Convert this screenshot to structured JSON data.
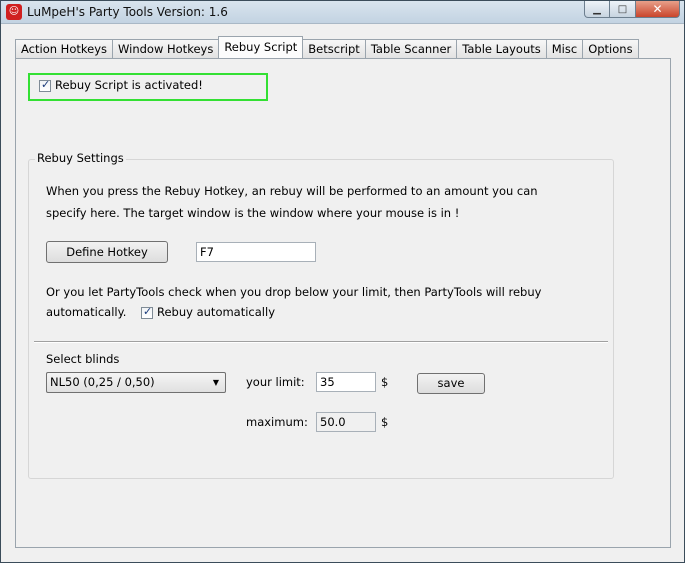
{
  "window": {
    "title": "LuMpeH's Party Tools   Version: 1.6",
    "icon": "app-icon"
  },
  "tabs": [
    {
      "label": "Action Hotkeys"
    },
    {
      "label": "Window Hotkeys"
    },
    {
      "label": "Rebuy Script",
      "active": true
    },
    {
      "label": "Betscript"
    },
    {
      "label": "Table Scanner"
    },
    {
      "label": "Table Layouts"
    },
    {
      "label": "Misc"
    },
    {
      "label": "Options"
    }
  ],
  "activation": {
    "label": "Rebuy Script is activated!",
    "checked": true,
    "highlight_color": "#33e033"
  },
  "rebuy": {
    "group_title": "Rebuy Settings",
    "desc_line1": "When you press the Rebuy Hotkey, an rebuy will be performed to an amount you can",
    "desc_line2": "specify here. The target window is the window where your mouse is in !",
    "define_hotkey_label": "Define Hotkey",
    "hotkey_value": "F7",
    "auto_line1": "Or you let PartyTools check when you drop below your limit, then PartyTools will rebuy",
    "auto_line2": "automatically.",
    "auto_checkbox_label": "Rebuy automatically",
    "auto_checked": true,
    "select_blinds_label": "Select blinds",
    "blinds_value": "NL50 (0,25 / 0,50)",
    "limit_label": "your limit:",
    "limit_value": "35",
    "currency": "$",
    "save_label": "save",
    "maximum_label": "maximum:",
    "maximum_value": "50.0"
  }
}
